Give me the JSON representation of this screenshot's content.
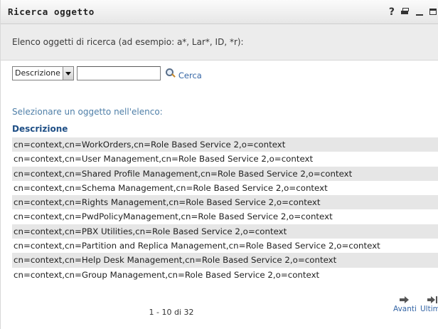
{
  "window": {
    "title": "Ricerca oggetto",
    "controls": [
      "help-icon",
      "print-icon",
      "minimize-icon",
      "maximize-icon"
    ],
    "help_glyph": "?"
  },
  "instructions": "Elenco oggetti di ricerca (ad esempio: a*, Lar*, ID, *r):",
  "search": {
    "attribute_selected": "Descrizione",
    "input_value": "",
    "button_label": "Cerca"
  },
  "results": {
    "prompt": "Selezionare un oggetto nell'elenco:",
    "column_header": "Descrizione",
    "rows": [
      "cn=context,cn=WorkOrders,cn=Role Based Service 2,o=context",
      "cn=context,cn=User Management,cn=Role Based Service 2,o=context",
      "cn=context,cn=Shared Profile Management,cn=Role Based Service 2,o=context",
      "cn=context,cn=Schema Management,cn=Role Based Service 2,o=context",
      "cn=context,cn=Rights Management,cn=Role Based Service 2,o=context",
      "cn=context,cn=PwdPolicyManagement,cn=Role Based Service 2,o=context",
      "cn=context,cn=PBX Utilities,cn=Role Based Service 2,o=context",
      "cn=context,cn=Partition and Replica Management,cn=Role Based Service 2,o=context",
      "cn=context,cn=Help Desk Management,cn=Role Based Service 2,o=context",
      "cn=context,cn=Group Management,cn=Role Based Service 2,o=context"
    ]
  },
  "pagination": {
    "range_text": "1 - 10 di 32",
    "next_label": "Avanti",
    "last_label": "Ultimo"
  },
  "colors": {
    "link": "#3566a6",
    "header_text": "#1f4f86",
    "row_alt": "#e6e6e6",
    "instructions_bg": "#ececec"
  }
}
